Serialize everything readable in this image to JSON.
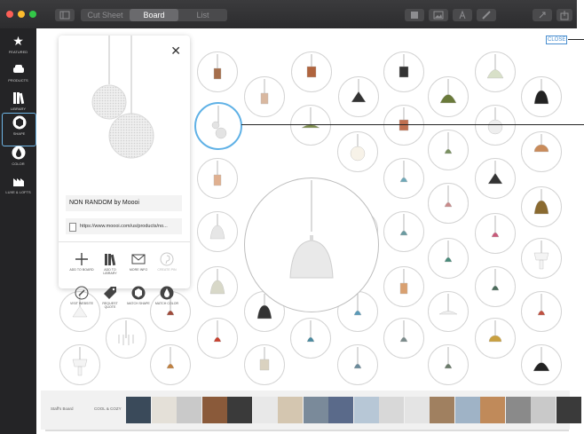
{
  "window": {
    "tabs": [
      {
        "label": "Cut Sheet",
        "active": false
      },
      {
        "label": "Board",
        "active": true
      },
      {
        "label": "List",
        "active": false
      }
    ],
    "toolbar_icons": [
      "grid-icon",
      "image-icon",
      "text-format-icon",
      "edit-pencil-icon",
      "expand-icon",
      "share-icon"
    ],
    "traffic_lights": [
      "#fc5f57",
      "#fdbc2e",
      "#33c748"
    ]
  },
  "sidebar": {
    "items": [
      {
        "label": "FEATURED",
        "icon": "star-icon",
        "selected": false
      },
      {
        "label": "PRODUCTS",
        "icon": "sofa-icon",
        "selected": false
      },
      {
        "label": "LIBRARY",
        "icon": "library-books-icon",
        "selected": false
      },
      {
        "label": "SHAPE",
        "icon": "cube-icon",
        "selected": true
      },
      {
        "label": "COLOR",
        "icon": "drop-icon",
        "selected": false
      },
      {
        "label": "LUXE & LOFTS",
        "icon": "factory-icon",
        "selected": false
      }
    ]
  },
  "board": {
    "close_label": "CLOSE"
  },
  "detail_card": {
    "product_name": "NON RANDOM by Moooi",
    "url": "https://www.moooi.com/us/products/no...",
    "actions": [
      {
        "label": "ADD TO BOARD",
        "icon": "plus-icon",
        "enabled": true
      },
      {
        "label": "ADD TO LIBRARY",
        "icon": "library-add-icon",
        "enabled": true
      },
      {
        "label": "MORE INFO",
        "icon": "mail-icon",
        "enabled": true
      },
      {
        "label": "CREATE PIN",
        "icon": "pin-icon",
        "enabled": false
      },
      {
        "label": "VISIT WEBSITE",
        "icon": "compass-icon",
        "enabled": true
      },
      {
        "label": "REQUEST QUOTE",
        "icon": "price-tag-icon",
        "enabled": true
      },
      {
        "label": "MATCH SHAPE",
        "icon": "cube-icon",
        "enabled": true
      },
      {
        "label": "MATCH COLOR",
        "icon": "drop-icon",
        "enabled": true
      }
    ]
  },
  "tray": {
    "board_name": "Staff's Board",
    "board_title": "COOL & COZY"
  },
  "colors": {
    "accent": "#5fb1e6",
    "titlebar": "#2f2f31",
    "sidebar": "#242426"
  }
}
